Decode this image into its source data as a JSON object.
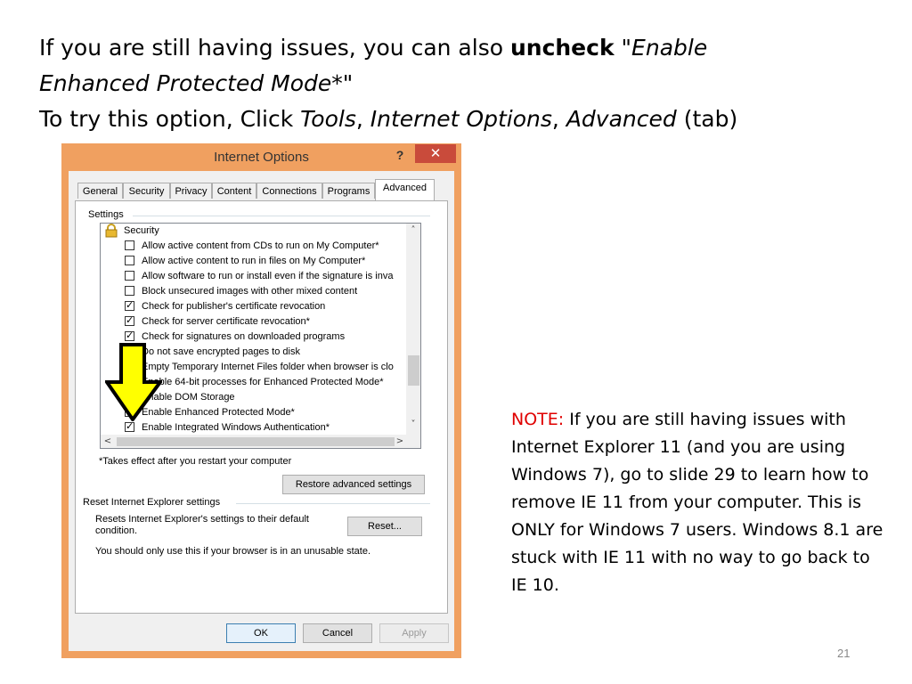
{
  "slide": {
    "heading_line1_prefix": "If you are still having issues, you can also ",
    "heading_line1_bold": "uncheck",
    "heading_line1_quote_open": " \"",
    "heading_line1_italic": "Enable",
    "heading_line2_italic": "Enhanced Protected Mode*",
    "heading_line2_quote_close": "\"",
    "heading_line3_prefix": "To try this option, Click ",
    "heading_line3_tools": "Tools",
    "heading_line3_sep1": ", ",
    "heading_line3_internet_options": "Internet Options",
    "heading_line3_sep2": ", ",
    "heading_line3_advanced": "Advanced",
    "heading_line3_suffix": " (tab)",
    "note_label": "NOTE:",
    "note_text": "  If you are still having issues with Internet Explorer 11 (and you are using Windows 7), go to slide 29 to learn how to remove IE 11 from your computer.  This is ONLY for Windows 7 users.  Windows 8.1 are stuck with IE 11 with no way to go back to IE 10.",
    "page_number": "21"
  },
  "dialog": {
    "title": "Internet Options",
    "help_label": "?",
    "close_label": "✕",
    "tabs": [
      "General",
      "Security",
      "Privacy",
      "Content",
      "Connections",
      "Programs",
      "Advanced"
    ],
    "active_tab": "Advanced",
    "settings_label": "Settings",
    "settings": {
      "category": "Security",
      "items": [
        {
          "label": "Allow active content from CDs to run on My Computer*",
          "checked": false
        },
        {
          "label": "Allow active content to run in files on My Computer*",
          "checked": false
        },
        {
          "label": "Allow software to run or install even if the signature is inva",
          "checked": false
        },
        {
          "label": "Block unsecured images with other mixed content",
          "checked": false
        },
        {
          "label": "Check for publisher's certificate revocation",
          "checked": true
        },
        {
          "label": "Check for server certificate revocation*",
          "checked": true
        },
        {
          "label": "Check for signatures on downloaded programs",
          "checked": true
        },
        {
          "label": "Do not save encrypted pages to disk",
          "checked": false
        },
        {
          "label": "Empty Temporary Internet Files folder when browser is clo",
          "checked": false
        },
        {
          "label": "Enable 64-bit processes for Enhanced Protected Mode*",
          "checked": false
        },
        {
          "label": "Enable DOM Storage",
          "checked": false
        },
        {
          "label": "Enable Enhanced Protected Mode*",
          "checked": false
        },
        {
          "label": "Enable Integrated Windows Authentication*",
          "checked": true
        }
      ]
    },
    "restart_note": "*Takes effect after you restart your computer",
    "restore_button": "Restore advanced settings",
    "reset_group_label": "Reset Internet Explorer settings",
    "reset_description_line1": "Resets Internet Explorer's settings to their default",
    "reset_description_line2": "condition.",
    "reset_button": "Reset...",
    "reset_warning": "You should only use this if your browser is in an unusable state.",
    "ok_button": "OK",
    "cancel_button": "Cancel",
    "apply_button": "Apply"
  },
  "colors": {
    "titlebar": "#f0a060",
    "close_button": "#c94b3b",
    "note_label": "#e00000",
    "arrow_fill": "#ffff00"
  }
}
